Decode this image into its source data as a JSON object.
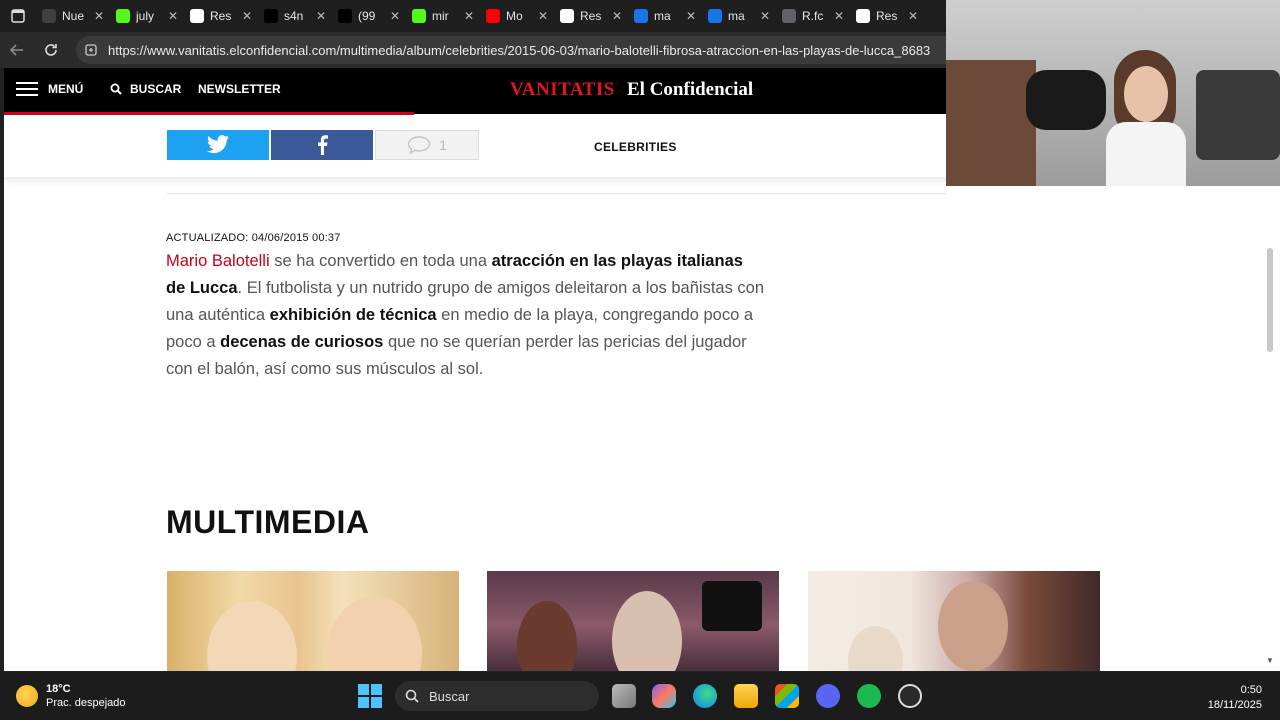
{
  "browser": {
    "tabs": [
      {
        "label": "Nue",
        "icon": "tab-page-icon",
        "color": "#3c4043"
      },
      {
        "label": "july",
        "icon": "k-app-icon",
        "color": "#53fc18"
      },
      {
        "label": "Res",
        "icon": "google-icon",
        "color": "#ffffff"
      },
      {
        "label": "s4n",
        "icon": "x-icon",
        "color": "#000000"
      },
      {
        "label": "(99",
        "icon": "tiktok-icon",
        "color": "#000000"
      },
      {
        "label": "mir",
        "icon": "k-app-icon",
        "color": "#53fc18"
      },
      {
        "label": "Mo",
        "icon": "youtube-icon",
        "color": "#ff0000"
      },
      {
        "label": "Res",
        "icon": "google-icon",
        "color": "#ffffff"
      },
      {
        "label": "ma",
        "icon": "search-icon",
        "color": "#1a73e8"
      },
      {
        "label": "ma",
        "icon": "search-icon",
        "color": "#1a73e8"
      },
      {
        "label": "R.fc",
        "icon": "globe-icon",
        "color": "#5f6368"
      },
      {
        "label": "Res",
        "icon": "google-icon",
        "color": "#ffffff"
      }
    ],
    "url": "https://www.vanitatis.elconfidencial.com/multimedia/album/celebrities/2015-06-03/mario-balotelli-fibrosa-atraccion-en-las-playas-de-lucca_8683"
  },
  "site": {
    "menu_label": "MENÚ",
    "search_label": "BUSCAR",
    "newsletter_label": "NEWSLETTER",
    "brand_vanitatis": "VANITATIS",
    "brand_confidencial": "El Confidencial",
    "comment_count": "1",
    "section": "CELEBRITIES",
    "accent": "#c4001a"
  },
  "article": {
    "updated": "ACTUALIZADO: 04/06/2015 00:37",
    "lead": {
      "p1_red": "Mario Balotelli",
      "p2": " se ha convertido en toda una ",
      "p3_bold": "atracción en las playas italianas de Lucca",
      "p4": ". El futbolista y un nutrido grupo de amigos deleitaron a los bañistas con una auténtica ",
      "p5_bold": "exhibición de técnica",
      "p6": " en medio de la playa, congregando poco a poco a ",
      "p7_bold": "decenas de curiosos",
      "p8": " que no se querían perder las pericias del jugador con el balón, así como sus músculos al sol."
    }
  },
  "multimedia": {
    "title": "MULTIMEDIA"
  },
  "taskbar": {
    "temp": "18°C",
    "weather": "Prac. despejado",
    "search_label": "Buscar",
    "time": "0:50",
    "date": "18/11/2025"
  }
}
